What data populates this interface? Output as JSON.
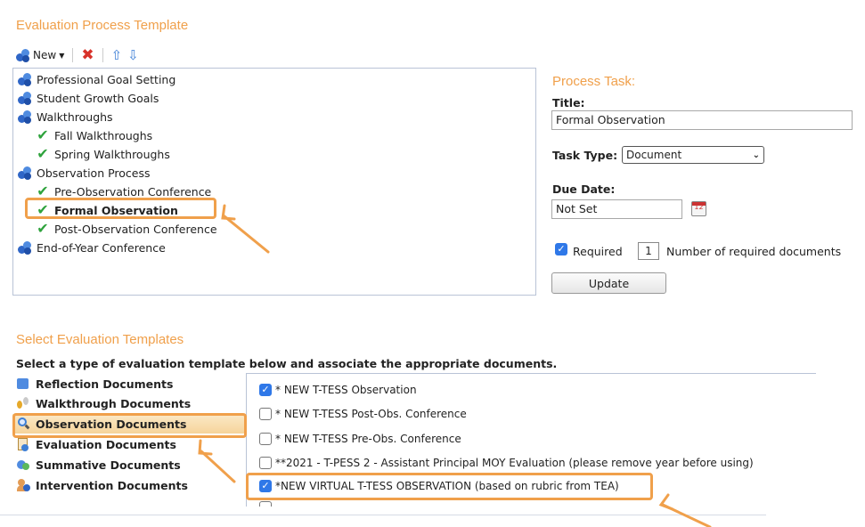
{
  "template_title": "Evaluation Process Template",
  "toolbar": {
    "new_label": "New"
  },
  "tree": [
    {
      "label": "Professional Goal Setting",
      "type": "group"
    },
    {
      "label": "Student Growth Goals",
      "type": "group"
    },
    {
      "label": "Walkthroughs",
      "type": "group"
    },
    {
      "label": "Fall Walkthroughs",
      "type": "task"
    },
    {
      "label": "Spring Walkthroughs",
      "type": "task"
    },
    {
      "label": "Observation Process",
      "type": "group"
    },
    {
      "label": "Pre-Observation Conference",
      "type": "task"
    },
    {
      "label": "Formal Observation",
      "type": "task",
      "selected": true
    },
    {
      "label": "Post-Observation Conference",
      "type": "task"
    },
    {
      "label": "End-of-Year Conference",
      "type": "group"
    }
  ],
  "process_task": {
    "heading": "Process Task:",
    "title_label": "Title:",
    "title_value": "Formal Observation",
    "task_type_label": "Task Type:",
    "task_type_value": "Document",
    "due_date_label": "Due Date:",
    "due_date_value": "Not Set",
    "required_label": "Required",
    "required_count": "1",
    "required_docs_label": "Number of required documents",
    "update_label": "Update"
  },
  "select_templates": {
    "heading": "Select Evaluation Templates",
    "instruction": "Select a type of evaluation template below and associate the appropriate documents.",
    "categories": [
      {
        "label": "Reflection Documents",
        "icon": "puzzle-icon"
      },
      {
        "label": "Walkthrough Documents",
        "icon": "footprints-icon"
      },
      {
        "label": "Observation Documents",
        "icon": "magnifier-icon",
        "selected": true
      },
      {
        "label": "Evaluation Documents",
        "icon": "evaluation-icon"
      },
      {
        "label": "Summative Documents",
        "icon": "summative-icon"
      },
      {
        "label": "Intervention Documents",
        "icon": "intervention-icon"
      }
    ],
    "documents": [
      {
        "label": "* NEW T-TESS Observation",
        "checked": true
      },
      {
        "label": "* NEW T-TESS Post-Obs. Conference",
        "checked": false
      },
      {
        "label": "* NEW T-TESS Pre-Obs. Conference",
        "checked": false
      },
      {
        "label": "**2021 - T-PESS 2 - Assistant Principal MOY Evaluation (please remove year before using)",
        "checked": false
      },
      {
        "label": "*NEW VIRTUAL T-TESS OBSERVATION (based on rubric from TEA)",
        "checked": true
      }
    ]
  },
  "colors": {
    "accent_orange": "#f0a04b",
    "check_green": "#2fa33d",
    "checkbox_blue": "#2f78e8"
  }
}
